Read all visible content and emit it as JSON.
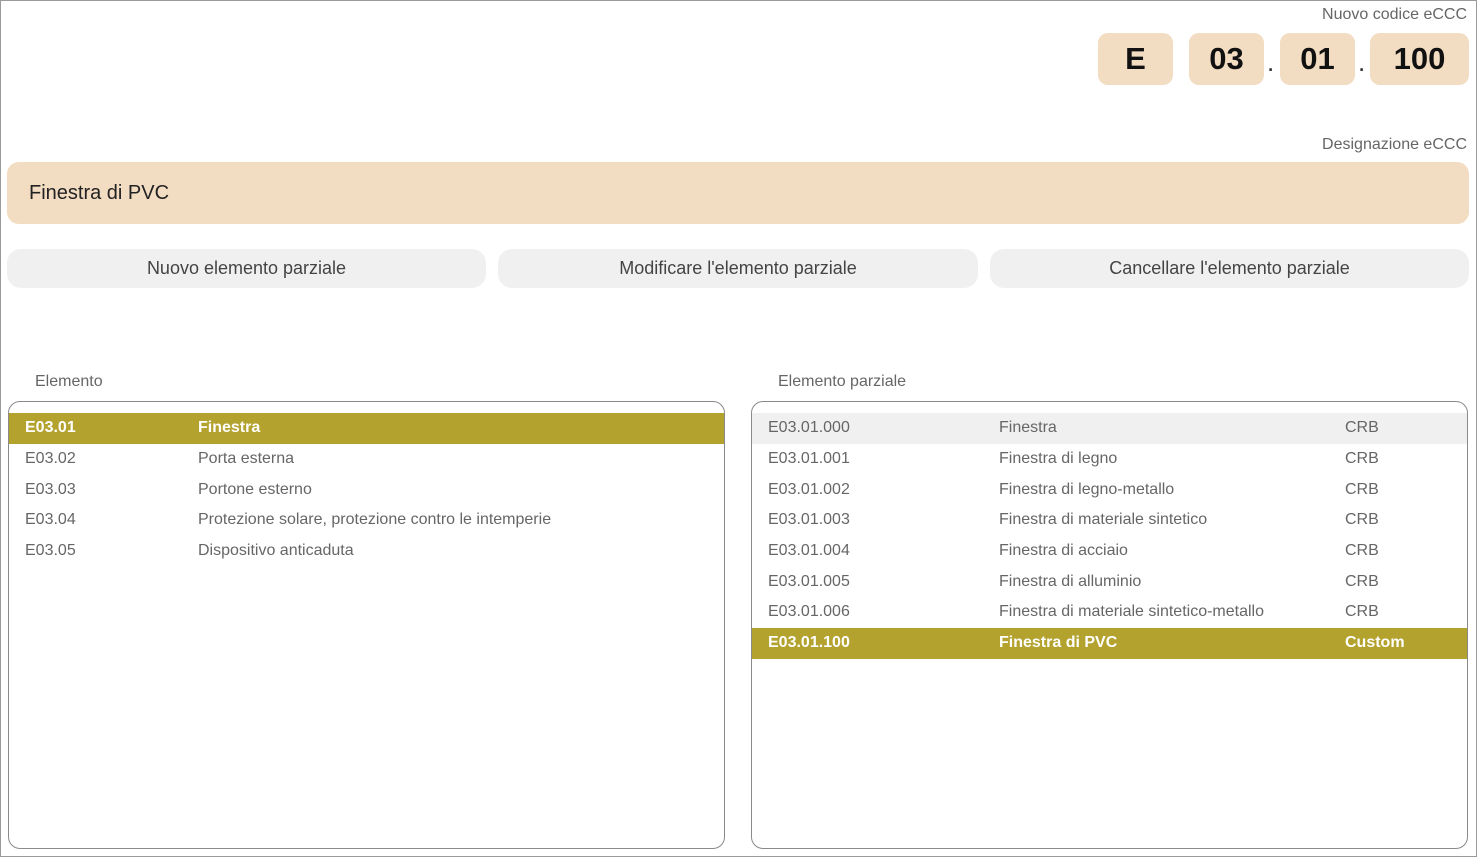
{
  "code": {
    "label": "Nuovo codice eCCC",
    "segments": [
      "E",
      "03",
      "01",
      "100"
    ],
    "separator": "."
  },
  "designation": {
    "label": "Designazione eCCC",
    "value": "Finestra di PVC"
  },
  "buttons": {
    "new": "Nuovo elemento parziale",
    "edit": "Modificare l'elemento parziale",
    "delete": "Cancellare l'elemento parziale"
  },
  "element_list": {
    "title": "Elemento",
    "rows": [
      {
        "code": "E03.01",
        "name": "Finestra",
        "selected": true
      },
      {
        "code": "E03.02",
        "name": "Porta esterna"
      },
      {
        "code": "E03.03",
        "name": "Portone esterno"
      },
      {
        "code": "E03.04",
        "name": "Protezione solare, protezione contro le intemperie"
      },
      {
        "code": "E03.05",
        "name": "Dispositivo anticaduta"
      }
    ]
  },
  "partial_list": {
    "title": "Elemento parziale",
    "rows": [
      {
        "code": "E03.01.000",
        "name": "Finestra",
        "source": "CRB",
        "highlight": true
      },
      {
        "code": "E03.01.001",
        "name": "Finestra di legno",
        "source": "CRB"
      },
      {
        "code": "E03.01.002",
        "name": "Finestra di legno-metallo",
        "source": "CRB"
      },
      {
        "code": "E03.01.003",
        "name": "Finestra di materiale sintetico",
        "source": "CRB"
      },
      {
        "code": "E03.01.004",
        "name": "Finestra di acciaio",
        "source": "CRB"
      },
      {
        "code": "E03.01.005",
        "name": "Finestra di alluminio",
        "source": "CRB"
      },
      {
        "code": "E03.01.006",
        "name": "Finestra di materiale sintetico-metallo",
        "source": "CRB"
      },
      {
        "code": "E03.01.100",
        "name": "Finestra di PVC",
        "source": "Custom",
        "selected": true
      }
    ]
  },
  "colors": {
    "field_bg": "#f2dcc2",
    "selection": "#b4a22e",
    "button_bg": "#f0f0f0"
  }
}
